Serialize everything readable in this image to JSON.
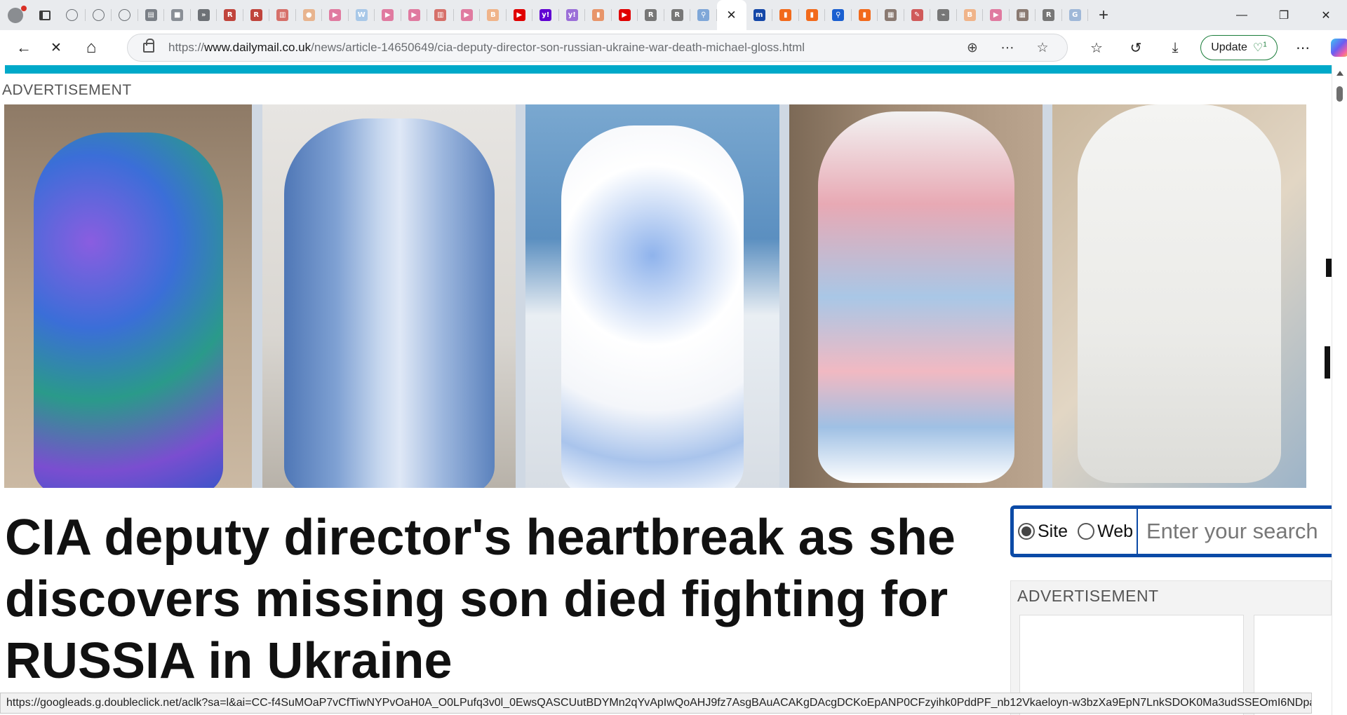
{
  "browser": {
    "tabs": [
      {
        "icon": "globe-icon",
        "color": "#6d7176",
        "glyph": ""
      },
      {
        "icon": "globe-icon",
        "color": "#6d7176",
        "glyph": ""
      },
      {
        "icon": "globe-icon",
        "color": "#6d7176",
        "glyph": ""
      },
      {
        "icon": "news-icon",
        "color": "#7a7f86",
        "glyph": "▤"
      },
      {
        "icon": "folder-icon",
        "color": "#8a8f96",
        "glyph": "■"
      },
      {
        "icon": "chevron-icon",
        "color": "#6d7176",
        "glyph": "»"
      },
      {
        "icon": "r-logo-icon",
        "color": "#c0443c",
        "glyph": "R"
      },
      {
        "icon": "r-logo-icon",
        "color": "#c0443c",
        "glyph": "R"
      },
      {
        "icon": "doc-icon",
        "color": "#d6706a",
        "glyph": "▥"
      },
      {
        "icon": "circle-icon",
        "color": "#e8b48f",
        "glyph": "●"
      },
      {
        "icon": "play-icon",
        "color": "#e07aa0",
        "glyph": "▶"
      },
      {
        "icon": "w-icon",
        "color": "#a8c8e8",
        "glyph": "W"
      },
      {
        "icon": "play-icon",
        "color": "#e07aa0",
        "glyph": "▶"
      },
      {
        "icon": "play-icon",
        "color": "#e07aa0",
        "glyph": "▶"
      },
      {
        "icon": "doc-icon",
        "color": "#d6706a",
        "glyph": "▥"
      },
      {
        "icon": "play-icon",
        "color": "#e07aa0",
        "glyph": "▶"
      },
      {
        "icon": "b-icon",
        "color": "#f0b48a",
        "glyph": "B"
      },
      {
        "icon": "youtube-icon",
        "color": "#e00000",
        "glyph": "▶"
      },
      {
        "icon": "yahoo-icon",
        "color": "#6001d2",
        "glyph": "y!"
      },
      {
        "icon": "yahoo-icon",
        "color": "#9b6fd8",
        "glyph": "y!"
      },
      {
        "icon": "bookmark-icon",
        "color": "#e8956a",
        "glyph": "▮"
      },
      {
        "icon": "youtube-icon",
        "color": "#e00000",
        "glyph": "▶"
      },
      {
        "icon": "r-logo-icon",
        "color": "#777777",
        "glyph": "R"
      },
      {
        "icon": "r-logo-icon",
        "color": "#777777",
        "glyph": "R"
      },
      {
        "icon": "search-icon",
        "color": "#7fa7d8",
        "glyph": "⚲"
      },
      {
        "icon": "m-logo-icon",
        "color": "#1447a8",
        "glyph": "m"
      },
      {
        "icon": "bookmark-icon",
        "color": "#f26a1b",
        "glyph": "▮"
      },
      {
        "icon": "bookmark-icon",
        "color": "#f26a1b",
        "glyph": "▮"
      },
      {
        "icon": "search-icon",
        "color": "#1a5fd0",
        "glyph": "⚲"
      },
      {
        "icon": "bookmark-icon",
        "color": "#f26a1b",
        "glyph": "▮"
      },
      {
        "icon": "photo-icon",
        "color": "#8a7a72",
        "glyph": "▦"
      },
      {
        "icon": "brush-icon",
        "color": "#d05a5a",
        "glyph": "✎"
      },
      {
        "icon": "chart-icon",
        "color": "#777777",
        "glyph": "⌁"
      },
      {
        "icon": "b-icon",
        "color": "#f0b48a",
        "glyph": "B"
      },
      {
        "icon": "play-icon",
        "color": "#e07aa0",
        "glyph": "▶"
      },
      {
        "icon": "photo-icon",
        "color": "#8a7a72",
        "glyph": "▦"
      },
      {
        "icon": "r-logo-icon",
        "color": "#777777",
        "glyph": "R"
      },
      {
        "icon": "google-icon",
        "color": "#9fb8d8",
        "glyph": "G"
      }
    ],
    "active_tab_close": "✕",
    "new_tab_label": "+",
    "window_controls": {
      "minimize": "—",
      "maximize": "❐",
      "close": "✕"
    },
    "nav": {
      "back": "←",
      "stop": "✕",
      "home": "⌂"
    },
    "url_prefix": "https://",
    "url_domain": "www.dailymail.co.uk",
    "url_path": "/news/article-14650649/cia-deputy-director-son-russian-ukraine-war-death-michael-gloss.html",
    "omnibox_icons": {
      "zoom": "⊕",
      "reader": "⋯",
      "favorite": "☆"
    },
    "toolbar_icons": {
      "favorites": "☆",
      "history": "↺",
      "downloads": "⤓",
      "more": "⋯"
    },
    "update_label": "Update",
    "update_badge": "1",
    "accent_color": "#00a9c9"
  },
  "page": {
    "ad_label_top": "ADVERTISEMENT",
    "headline": "CIA deputy director's heartbreak as she discovers missing son died fighting for RUSSIA in Ukraine",
    "search": {
      "site_label": "Site",
      "web_label": "Web",
      "placeholder": "Enter your search"
    },
    "ad_label_side": "ADVERTISEMENT"
  },
  "status_url": "https://googleads.g.doubleclick.net/aclk?sa=l&ai=CC-f4SuMOaP7vCfTiwNYPvOaH0A_O0LPufq3v0l_0EwsQASCUutBDYMn2qYvApIwQoAHJ9fz7AsgBAuACAKgDAcgDCKoEpANP0CFzyihk0PddPF_nb12Vkaeloyn-w3bzXa9EpN7LnkSDOK0Ma3udSSEOmI6NDpan7YXtoLSIW1dnGOXEuIT..."
}
